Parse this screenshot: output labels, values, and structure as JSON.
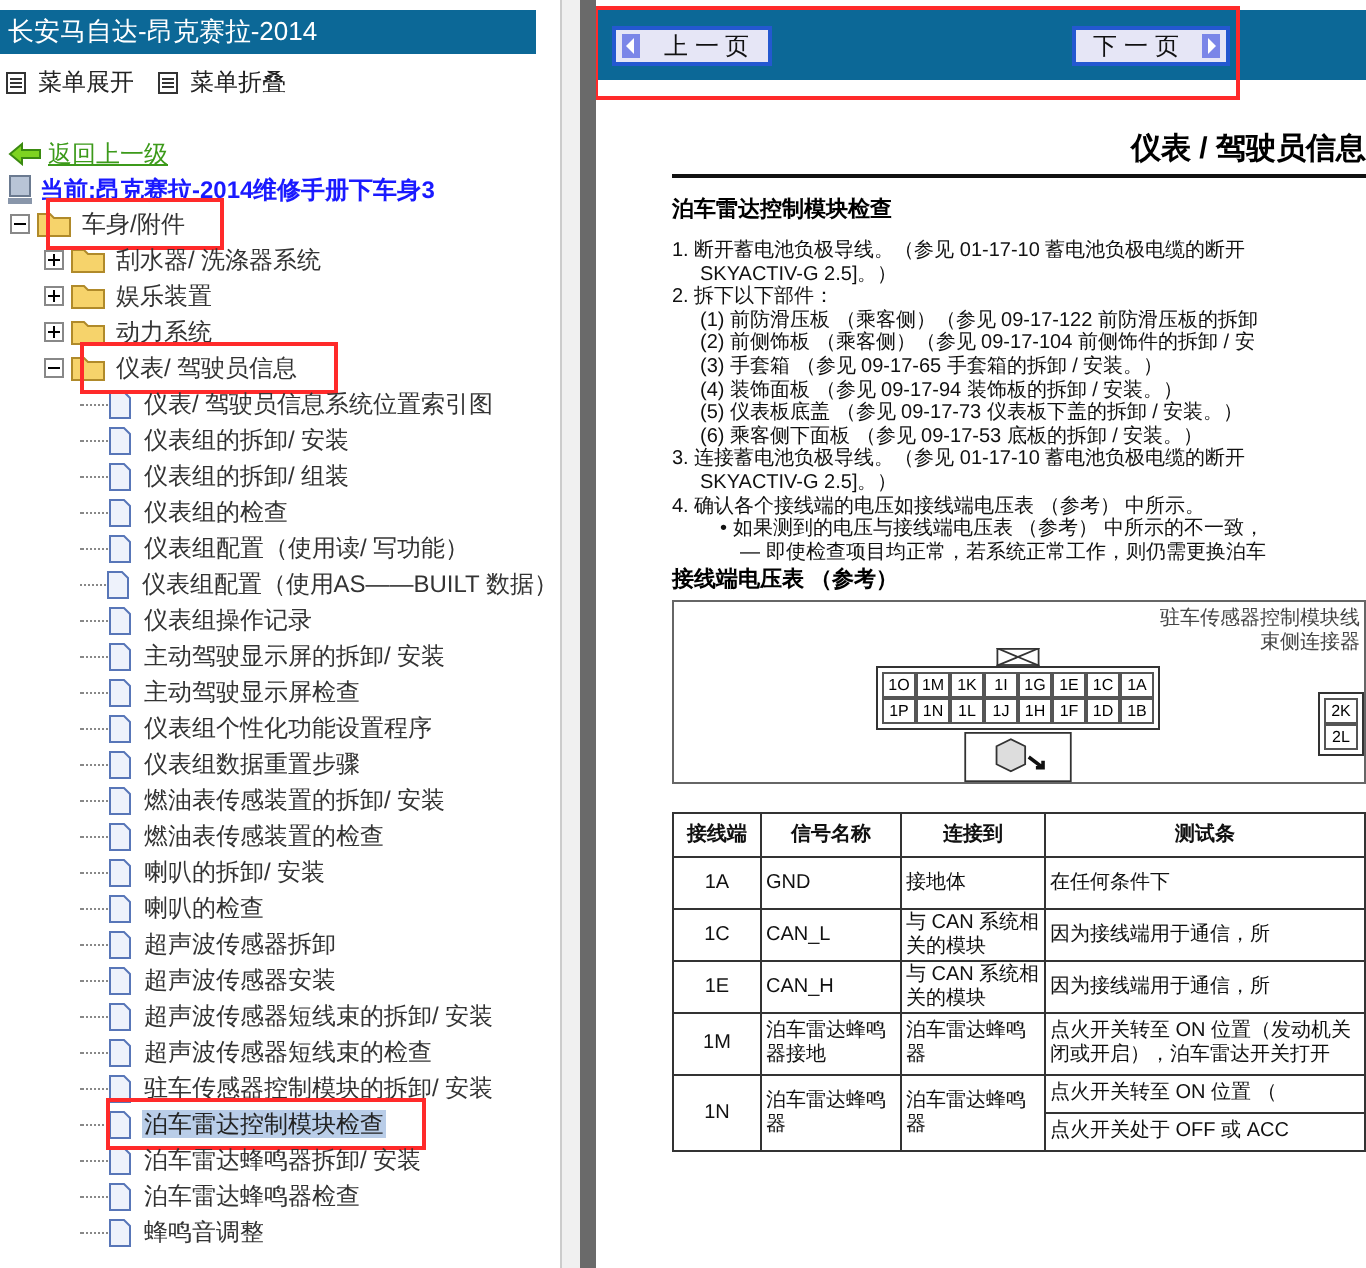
{
  "sidebar": {
    "title": "长安马自达-昂克赛拉-2014",
    "menu": [
      {
        "label": "菜单展开"
      },
      {
        "label": "菜单折叠"
      }
    ],
    "back_link": "返回上一级",
    "current": "当前:昂克赛拉-2014维修手册下车身3",
    "tree": [
      {
        "kind": "folder",
        "label": "车身/附件",
        "expanded": true,
        "marked": true,
        "children": [
          {
            "kind": "folder",
            "label": "刮水器/ 洗涤器系统",
            "expanded": false,
            "marked": false
          },
          {
            "kind": "folder",
            "label": "娱乐装置",
            "expanded": false,
            "marked": false
          },
          {
            "kind": "folder",
            "label": "动力系统",
            "expanded": false,
            "marked": false
          },
          {
            "kind": "folder",
            "label": "仪表/ 驾驶员信息",
            "expanded": true,
            "marked": true,
            "children": [
              {
                "kind": "page",
                "label": "仪表/ 驾驶员信息系统位置索引图",
                "selected": false,
                "marked": false
              },
              {
                "kind": "page",
                "label": "仪表组的拆卸/ 安装",
                "selected": false,
                "marked": false
              },
              {
                "kind": "page",
                "label": "仪表组的拆卸/ 组装",
                "selected": false,
                "marked": false
              },
              {
                "kind": "page",
                "label": "仪表组的检查",
                "selected": false,
                "marked": false
              },
              {
                "kind": "page",
                "label": "仪表组配置（使用读/ 写功能）",
                "selected": false,
                "marked": false
              },
              {
                "kind": "page",
                "label": "仪表组配置（使用AS——BUILT 数据）",
                "selected": false,
                "marked": false
              },
              {
                "kind": "page",
                "label": "仪表组操作记录",
                "selected": false,
                "marked": false
              },
              {
                "kind": "page",
                "label": "主动驾驶显示屏的拆卸/ 安装",
                "selected": false,
                "marked": false
              },
              {
                "kind": "page",
                "label": "主动驾驶显示屏检查",
                "selected": false,
                "marked": false
              },
              {
                "kind": "page",
                "label": "仪表组个性化功能设置程序",
                "selected": false,
                "marked": false
              },
              {
                "kind": "page",
                "label": "仪表组数据重置步骤",
                "selected": false,
                "marked": false
              },
              {
                "kind": "page",
                "label": "燃油表传感装置的拆卸/ 安装",
                "selected": false,
                "marked": false
              },
              {
                "kind": "page",
                "label": "燃油表传感装置的检查",
                "selected": false,
                "marked": false
              },
              {
                "kind": "page",
                "label": "喇叭的拆卸/ 安装",
                "selected": false,
                "marked": false
              },
              {
                "kind": "page",
                "label": "喇叭的检查",
                "selected": false,
                "marked": false
              },
              {
                "kind": "page",
                "label": "超声波传感器拆卸",
                "selected": false,
                "marked": false
              },
              {
                "kind": "page",
                "label": "超声波传感器安装",
                "selected": false,
                "marked": false
              },
              {
                "kind": "page",
                "label": "超声波传感器短线束的拆卸/ 安装",
                "selected": false,
                "marked": false
              },
              {
                "kind": "page",
                "label": "超声波传感器短线束的检查",
                "selected": false,
                "marked": false
              },
              {
                "kind": "page",
                "label": "驻车传感器控制模块的拆卸/ 安装",
                "selected": false,
                "marked": false
              },
              {
                "kind": "page",
                "label": "泊车雷达控制模块检查",
                "selected": true,
                "marked": true
              },
              {
                "kind": "page",
                "label": "泊车雷达蜂鸣器拆卸/ 安装",
                "selected": false,
                "marked": false
              },
              {
                "kind": "page",
                "label": "泊车雷达蜂鸣器检查",
                "selected": false,
                "marked": false
              },
              {
                "kind": "page",
                "label": "蜂鸣音调整",
                "selected": false,
                "marked": false
              }
            ]
          }
        ]
      }
    ]
  },
  "nav": {
    "marked": true,
    "prev": "上 一 页",
    "next": "下 一 页"
  },
  "doc": {
    "section": "仪表 / 驾驶员信息",
    "heading": "泊车雷达控制模块检查",
    "lines": [
      {
        "kind": "step",
        "marker": "1.",
        "text": "断开蓄电池负极导线。（参见 01-17-10 蓄电池负极电缆的断开"
      },
      {
        "kind": "cont",
        "text": "SKYACTIV-G 2.5]。）"
      },
      {
        "kind": "step",
        "marker": "2.",
        "text": "拆下以下部件："
      },
      {
        "kind": "sub",
        "marker": "(1)",
        "text": "前防滑压板 （乘客侧）（参见 09-17-122 前防滑压板的拆卸"
      },
      {
        "kind": "sub",
        "marker": "(2)",
        "text": "前侧饰板 （乘客侧）（参见 09-17-104 前侧饰件的拆卸 / 安"
      },
      {
        "kind": "sub",
        "marker": "(3)",
        "text": "手套箱 （参见 09-17-65 手套箱的拆卸 / 安装。）"
      },
      {
        "kind": "sub",
        "marker": "(4)",
        "text": "装饰面板 （参见 09-17-94 装饰板的拆卸 / 安装。）"
      },
      {
        "kind": "sub",
        "marker": "(5)",
        "text": "仪表板底盖 （参见 09-17-73 仪表板下盖的拆卸 / 安装。）"
      },
      {
        "kind": "sub",
        "marker": "(6)",
        "text": "乘客侧下面板 （参见 09-17-53 底板的拆卸 / 安装。）"
      },
      {
        "kind": "step",
        "marker": "3.",
        "text": "连接蓄电池负极导线。（参见 01-17-10 蓄电池负极电缆的断开"
      },
      {
        "kind": "cont",
        "text": "SKYACTIV-G 2.5]。）"
      },
      {
        "kind": "step",
        "marker": "4.",
        "text": "确认各个接线端的电压如接线端电压表 （参考） 中所示。"
      },
      {
        "kind": "bullet",
        "marker": "•",
        "text": "如果测到的电压与接线端电压表 （参考） 中所示的不一致，"
      },
      {
        "kind": "dash",
        "marker": "—",
        "text": "即使检查项目均正常，若系统正常工作，则仍需更换泊车"
      }
    ],
    "table_title": "接线端电压表 （参考）",
    "connector": {
      "caption": [
        "驻车传感器控制模块线",
        "束侧连接器"
      ],
      "pins": [
        [
          "1O",
          "1M",
          "1K",
          "1I",
          "1G",
          "1E",
          "1C",
          "1A"
        ],
        [
          "1P",
          "1N",
          "1L",
          "1J",
          "1H",
          "1F",
          "1D",
          "1B"
        ]
      ],
      "pins_2": [
        "2K",
        "2L"
      ]
    },
    "table": {
      "columns": [
        "接线端",
        "信号名称",
        "连接到",
        "测试条"
      ],
      "rows": [
        {
          "terminal": "1A",
          "signal": "GND",
          "connects": "接地体",
          "conditions": [
            "在任何条件下"
          ]
        },
        {
          "terminal": "1C",
          "signal": "CAN_L",
          "connects": "与 CAN 系统相关的模块",
          "conditions": [
            "因为接线端用于通信，所"
          ]
        },
        {
          "terminal": "1E",
          "signal": "CAN_H",
          "connects": "与 CAN 系统相关的模块",
          "conditions": [
            "因为接线端用于通信，所"
          ]
        },
        {
          "terminal": "1M",
          "signal": "泊车雷达蜂鸣器接地",
          "connects": "泊车雷达蜂鸣器",
          "conditions": [
            "点火开关转至 ON 位置（发动机关闭或开启），泊车雷达开关打开"
          ]
        },
        {
          "terminal": "1N",
          "signal": "泊车雷达蜂鸣器",
          "connects": "泊车雷达蜂鸣器",
          "conditions": [
            "点火开关转至 ON 位置 （",
            "点火开关处于 OFF 或 ACC"
          ]
        }
      ]
    }
  }
}
